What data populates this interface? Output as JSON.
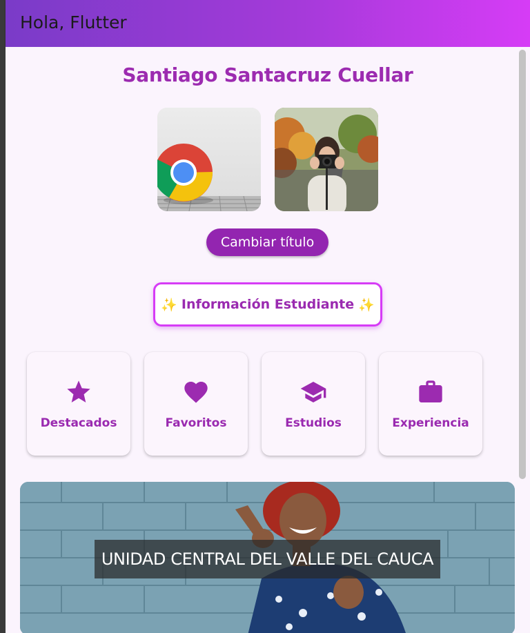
{
  "app_bar": {
    "title": "Hola, Flutter"
  },
  "profile": {
    "name": "Santiago Santacruz Cuellar"
  },
  "images": [
    {
      "name": "chrome-logo-image"
    },
    {
      "name": "photographer-image"
    }
  ],
  "buttons": {
    "change_title_label": "Cambiar título",
    "student_info_label": "Información Estudiante",
    "sparkle_glyph": "✨"
  },
  "cards": [
    {
      "label": "Destacados",
      "icon": "star-icon"
    },
    {
      "label": "Favoritos",
      "icon": "heart-icon"
    },
    {
      "label": "Estudios",
      "icon": "graduation-cap-icon"
    },
    {
      "label": "Experiencia",
      "icon": "briefcase-icon"
    }
  ],
  "banner": {
    "caption": "UNIDAD CENTRAL DEL VALLE DEL CAUCA"
  },
  "colors": {
    "accent": "#9c2bb0",
    "button": "#9325b0",
    "appbar_start": "#7a3bc8",
    "appbar_end": "#d63cf6",
    "background": "#fbf4fd"
  }
}
